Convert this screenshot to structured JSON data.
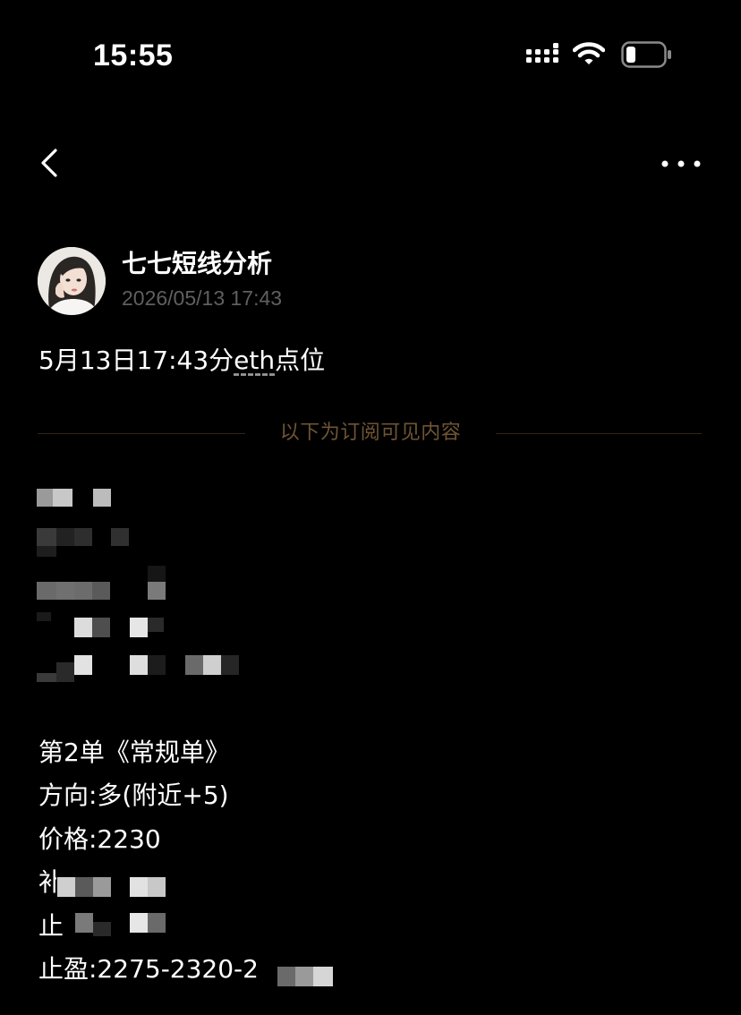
{
  "status_bar": {
    "time": "15:55"
  },
  "author": {
    "name": "七七短线分析",
    "post_time": "2026/05/13 17:43"
  },
  "post": {
    "title_prefix": "5月13日17:43分",
    "title_link": "eth",
    "title_suffix": "点位"
  },
  "divider": {
    "text": "以下为订阅可见内容"
  },
  "order": {
    "heading": "第2单《常规单》",
    "direction": "方向:多(附近+5)",
    "price": "价格:2230",
    "stop_loss_partial": "补",
    "stop_loss2_partial": "止",
    "take_profit_partial": "止盈:2275-2320-2"
  },
  "colors": {
    "background": "#000000",
    "text": "#ffffff",
    "muted": "#5f5f5f",
    "divider_text": "#6e5434",
    "divider_line": "#2f2619"
  }
}
